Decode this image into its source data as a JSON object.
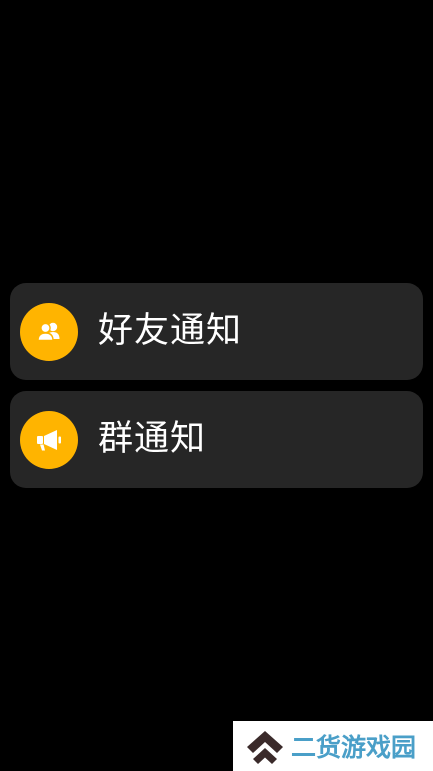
{
  "notifications": {
    "items": [
      {
        "label": "好友通知",
        "icon": "friends-icon"
      },
      {
        "label": "群通知",
        "icon": "megaphone-icon"
      }
    ],
    "accent_color": "#FFB400",
    "card_color": "#262626"
  },
  "watermark": {
    "text": "二货游戏园",
    "icon": "logo-chevron-icon",
    "text_color": "#4A9FC8"
  }
}
